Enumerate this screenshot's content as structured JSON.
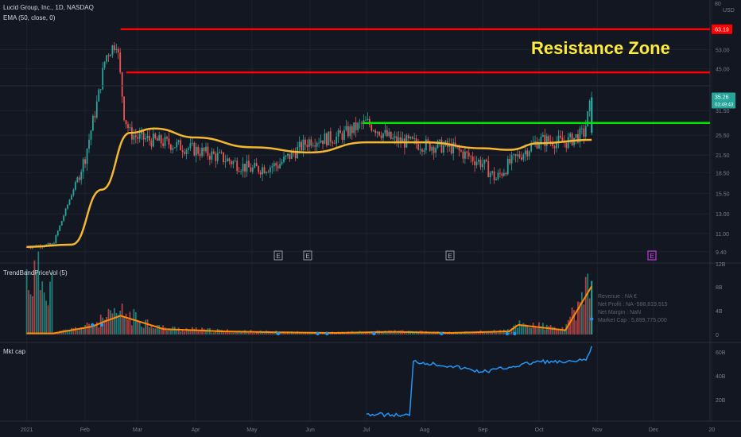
{
  "header": {
    "symbol_line": "Lucid Group, Inc., 1D, NASDAQ",
    "ema_line": "EMA (50, close, 0)"
  },
  "colors": {
    "background": "#131722",
    "grid": "#1e222d",
    "up": "#26a69a",
    "down": "#ef5350",
    "ema": "#f5b630",
    "resistance": "#ff0000",
    "support": "#00e600",
    "mktcap": "#2196f3",
    "annotation": "#ffeb3b"
  },
  "annotation": {
    "text": "Resistance Zone"
  },
  "price_axis": {
    "top_label": "80",
    "currency": "USD",
    "ticks": [
      "63.19",
      "53.00",
      "45.00",
      "35.26",
      "31.50",
      "25.50",
      "21.50",
      "18.50",
      "15.50",
      "13.00",
      "11.00",
      "9.40"
    ],
    "current_price": "35.26",
    "countdown": "03:49:43"
  },
  "time_axis": {
    "labels": [
      "2021",
      "Feb",
      "Mar",
      "Apr",
      "May",
      "Jun",
      "Jul",
      "Aug",
      "Sep",
      "Oct",
      "Nov",
      "Dec",
      "20"
    ]
  },
  "earnings_markers": [
    "E",
    "E",
    "E",
    "E"
  ],
  "volume_panel": {
    "title": "TrendBandPriceVol (5)",
    "ticks": [
      "12B",
      "8B",
      "4B",
      "0"
    ],
    "info": [
      "Revenue : NA €",
      "Net Profit : NA -588,819,915",
      "Net Margin : NaN",
      "Market Cap : 5,899,775,000"
    ]
  },
  "mktcap_panel": {
    "title": "Mkt cap",
    "ticks": [
      "60B",
      "40B",
      "20B"
    ]
  },
  "chart_data": [
    {
      "type": "line",
      "title": "Lucid Group, Inc., 1D, NASDAQ",
      "scale": "log",
      "x": [
        "2021-01-01",
        "2021-01-15",
        "2021-02-01",
        "2021-02-08",
        "2021-02-12",
        "2021-02-18",
        "2021-02-22",
        "2021-02-25",
        "2021-03-01",
        "2021-03-15",
        "2021-04-01",
        "2021-04-15",
        "2021-05-01",
        "2021-05-15",
        "2021-06-01",
        "2021-06-15",
        "2021-07-01",
        "2021-07-15",
        "2021-08-01",
        "2021-08-15",
        "2021-09-01",
        "2021-09-08",
        "2021-09-15",
        "2021-10-01",
        "2021-10-15",
        "2021-10-25",
        "2021-10-29"
      ],
      "close": [
        9.8,
        10.0,
        21.0,
        35.0,
        50.0,
        57.0,
        30.0,
        26.0,
        25.0,
        24.0,
        22.5,
        21.0,
        19.0,
        19.8,
        24.5,
        25.0,
        28.5,
        24.5,
        23.5,
        23.0,
        20.0,
        17.5,
        20.0,
        24.5,
        24.0,
        26.0,
        35.26
      ],
      "series": [
        {
          "name": "EMA (50, close, 0)",
          "x": [
            "2021-01-01",
            "2021-01-25",
            "2021-02-10",
            "2021-02-25",
            "2021-03-10",
            "2021-04-01",
            "2021-05-01",
            "2021-06-01",
            "2021-07-01",
            "2021-08-01",
            "2021-09-01",
            "2021-09-15",
            "2021-10-01",
            "2021-10-29"
          ],
          "values": [
            9.8,
            10.0,
            16.0,
            26.0,
            27.0,
            25.0,
            23.0,
            22.0,
            24.0,
            24.0,
            22.8,
            22.5,
            23.8,
            24.5
          ]
        }
      ],
      "levels": [
        {
          "label": "63.19",
          "value": 63.19,
          "color": "#ff0000"
        },
        {
          "label": "43.66",
          "value": 43.66,
          "color": "#ff0000"
        },
        {
          "label": "28.31",
          "value": 28.31,
          "color": "#00e600"
        }
      ],
      "ylim": [
        8.6,
        80
      ]
    },
    {
      "type": "bar",
      "title": "TrendBandPriceVol (5)",
      "ylabel": "Volume",
      "x": [
        "2021-01",
        "2021-02-05",
        "2021-02-12",
        "2021-02-20",
        "2021-03",
        "2021-04",
        "2021-05",
        "2021-06",
        "2021-07",
        "2021-08",
        "2021-09",
        "2021-09-20",
        "2021-10",
        "2021-10-29"
      ],
      "values": [
        0.2,
        1.5,
        2.5,
        3.5,
        1.0,
        0.6,
        0.4,
        0.3,
        0.5,
        0.3,
        0.6,
        1.8,
        0.8,
        9.0
      ],
      "ylim": [
        0,
        12
      ]
    },
    {
      "type": "line",
      "title": "Mkt cap",
      "x": [
        "2021-07-01",
        "2021-07-20",
        "2021-07-24",
        "2021-07-26",
        "2021-08-15",
        "2021-09-01",
        "2021-09-15",
        "2021-10-01",
        "2021-10-15",
        "2021-10-26",
        "2021-10-29"
      ],
      "values": [
        7,
        6,
        6,
        52,
        48,
        43,
        47,
        52,
        51,
        53,
        65
      ],
      "ylim": [
        0,
        70
      ]
    }
  ]
}
